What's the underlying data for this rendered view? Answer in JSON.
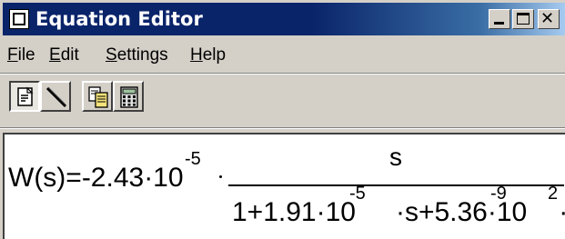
{
  "window": {
    "title": "Equation Editor",
    "caption_buttons": [
      "minimize",
      "maximize",
      "close"
    ]
  },
  "menu": {
    "items": [
      {
        "label": "File",
        "mnemonic": "F",
        "rest": "ile"
      },
      {
        "label": "Edit",
        "mnemonic": "E",
        "rest": "dit"
      },
      {
        "label": "Settings",
        "mnemonic": "S",
        "rest": "ettings"
      },
      {
        "label": "Help",
        "mnemonic": "H",
        "rest": "elp"
      }
    ]
  },
  "toolbar": {
    "buttons": [
      {
        "icon": "text-mode-icon",
        "pressed": true
      },
      {
        "icon": "pen-icon",
        "pressed": false
      },
      {
        "icon": "copy-icon",
        "pressed": false
      },
      {
        "icon": "calculator-icon",
        "pressed": false
      }
    ]
  },
  "equation": {
    "lhs": "W(s)=-2.43·10",
    "lhs_exponent": "-5",
    "numerator": "s",
    "denominator": {
      "part1": "1+1.91·10",
      "exp1": "-5",
      "part2": "·s+5.36·10",
      "exp2": "-9",
      "part3": "·s",
      "exp3": "2"
    }
  },
  "colors": {
    "titlebar_start": "#0a246a",
    "titlebar_end": "#a6caf0",
    "face": "#d4d0c8"
  }
}
